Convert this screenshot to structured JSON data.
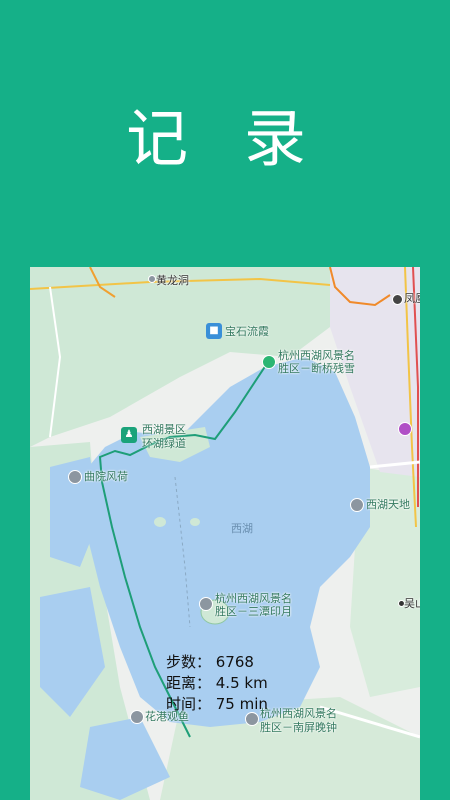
{
  "header": {
    "title": "记 录"
  },
  "map": {
    "labels": {
      "huanglongdong": "黄龙洞",
      "baoshi": "宝石流霞",
      "duanqiao_1": "杭州西湖风景名",
      "duanqiao_2": "胜区－断桥残雪",
      "huanhu_1": "西湖景区",
      "huanhu_2": "环湖绿道",
      "quyuan": "曲院风荷",
      "xihu_tiandi": "西湖天地",
      "xihu": "西湖",
      "santan_1": "杭州西湖风景名",
      "santan_2": "胜区－三潭印月",
      "huagang": "花港观鱼",
      "nanping_1": "杭州西湖风景名",
      "nanping_2": "胜区－南屏晚钟",
      "wushan": "吴山",
      "fenghuang": "凤凰"
    }
  },
  "stats": {
    "steps": "步数： 6768",
    "distance": "距离： 4.5 km",
    "time": "时间： 75 min"
  },
  "colors": {
    "brand": "#15b088",
    "lake": "#a9cef0",
    "route": "#1e9e78"
  }
}
